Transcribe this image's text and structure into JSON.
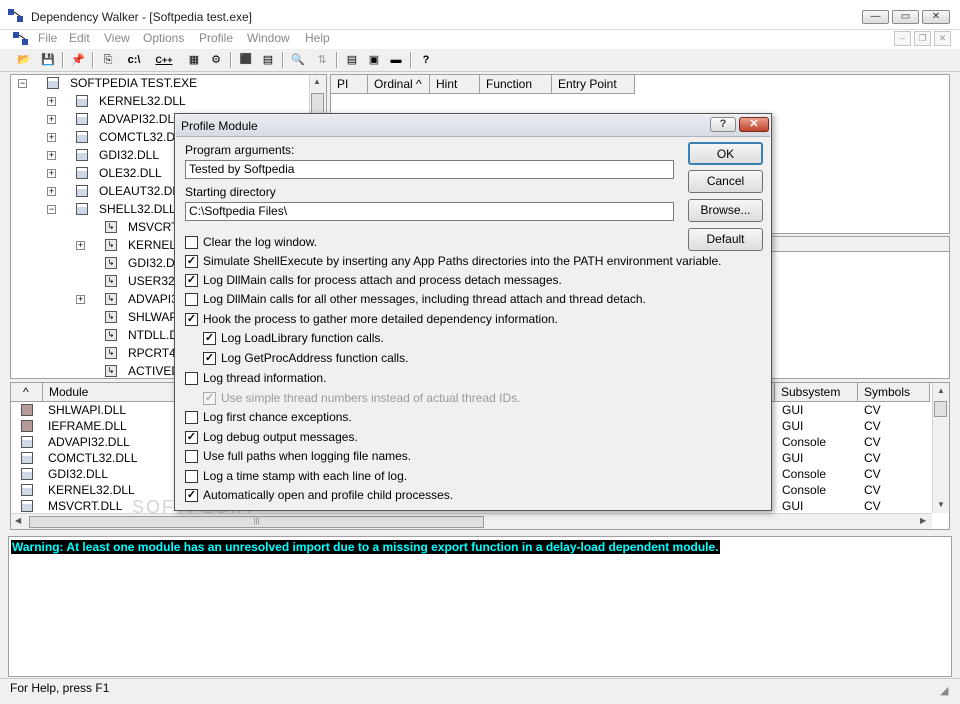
{
  "window": {
    "title": "Dependency Walker - [Softpedia test.exe]",
    "minimize": "—",
    "maximize": "▭",
    "close": "✕"
  },
  "menu": [
    "File",
    "Edit",
    "View",
    "Options",
    "Profile",
    "Window",
    "Help"
  ],
  "mdi_buttons": [
    "‒",
    "❐",
    "✕"
  ],
  "toolbar": [
    "📂",
    "💾",
    "📌",
    "⎘",
    "c:\\",
    "C++",
    "▦",
    "⚙",
    "⬛",
    "▤",
    "🔍",
    "⇅",
    "▤",
    "▣",
    "▬",
    "▥",
    "?"
  ],
  "tree": {
    "root": "SOFTPEDIA TEST.EXE",
    "items": [
      {
        "label": "KERNEL32.DLL"
      },
      {
        "label": "ADVAPI32.DLL"
      },
      {
        "label": "COMCTL32.DLL"
      },
      {
        "label": "GDI32.DLL"
      },
      {
        "label": "OLE32.DLL"
      },
      {
        "label": "OLEAUT32.DLL"
      },
      {
        "label": "SHELL32.DLL"
      },
      {
        "label": "MSVCRT"
      },
      {
        "label": "KERNEL3"
      },
      {
        "label": "GDI32.DL"
      },
      {
        "label": "USER32.D"
      },
      {
        "label": "ADVAPI3"
      },
      {
        "label": "SHLWAPI"
      },
      {
        "label": "NTDLL.DL"
      },
      {
        "label": "RPCRT4."
      },
      {
        "label": "ACTIVED"
      }
    ]
  },
  "import_headers": [
    "PI",
    "Ordinal ^",
    "Hint",
    "Function",
    "Entry Point"
  ],
  "module_list": {
    "headers": [
      "^",
      "Module",
      "Subsystem",
      "Symbols"
    ],
    "rows": [
      {
        "module": "SHLWAPI.DLL",
        "subsystem": "GUI",
        "symbols": "CV"
      },
      {
        "module": "IEFRAME.DLL",
        "subsystem": "GUI",
        "symbols": "CV"
      },
      {
        "module": "ADVAPI32.DLL",
        "subsystem": "Console",
        "symbols": "CV"
      },
      {
        "module": "COMCTL32.DLL",
        "subsystem": "GUI",
        "symbols": "CV"
      },
      {
        "module": "GDI32.DLL",
        "subsystem": "Console",
        "symbols": "CV"
      },
      {
        "module": "KERNEL32.DLL",
        "subsystem": "Console",
        "symbols": "CV"
      },
      {
        "module": "MSVCRT.DLL",
        "subsystem": "GUI",
        "symbols": "CV"
      }
    ]
  },
  "log": {
    "warning": "Warning: At least one module has an unresolved import due to a missing export function in a delay-load dependent module."
  },
  "status": "For Help, press F1",
  "watermark": "SOFTPEDIA",
  "dialog": {
    "title": "Profile Module",
    "help_btn": "?",
    "close_btn": "✕",
    "args_label": "Program arguments:",
    "args_value": "Tested by Softpedia",
    "dir_label": "Starting directory",
    "dir_value": "C:\\Softpedia Files\\",
    "ok": "OK",
    "cancel": "Cancel",
    "browse": "Browse...",
    "default": "Default",
    "options": [
      {
        "label": "Clear the log window.",
        "checked": false,
        "disabled": false,
        "indent": false
      },
      {
        "label": "Simulate ShellExecute by inserting any App Paths directories into the PATH environment variable.",
        "checked": true,
        "disabled": false,
        "indent": false
      },
      {
        "label": "Log DllMain calls for process attach and process detach messages.",
        "checked": true,
        "disabled": false,
        "indent": false
      },
      {
        "label": "Log DllMain calls for all other messages, including thread attach and thread detach.",
        "checked": false,
        "disabled": false,
        "indent": false
      },
      {
        "label": "Hook the process to gather more detailed dependency information.",
        "checked": true,
        "disabled": false,
        "indent": false
      },
      {
        "label": "Log LoadLibrary function calls.",
        "checked": true,
        "disabled": false,
        "indent": true
      },
      {
        "label": "Log GetProcAddress function calls.",
        "checked": true,
        "disabled": false,
        "indent": true
      },
      {
        "label": "Log thread information.",
        "checked": false,
        "disabled": false,
        "indent": false
      },
      {
        "label": "Use simple thread numbers instead of actual thread IDs.",
        "checked": true,
        "disabled": true,
        "indent": true
      },
      {
        "label": "Log first chance exceptions.",
        "checked": false,
        "disabled": false,
        "indent": false
      },
      {
        "label": "Log debug output messages.",
        "checked": true,
        "disabled": false,
        "indent": false
      },
      {
        "label": "Use full paths when logging file names.",
        "checked": false,
        "disabled": false,
        "indent": false
      },
      {
        "label": "Log a time stamp with each line of log.",
        "checked": false,
        "disabled": false,
        "indent": false
      },
      {
        "label": "Automatically open and profile child processes.",
        "checked": true,
        "disabled": false,
        "indent": false
      }
    ]
  }
}
